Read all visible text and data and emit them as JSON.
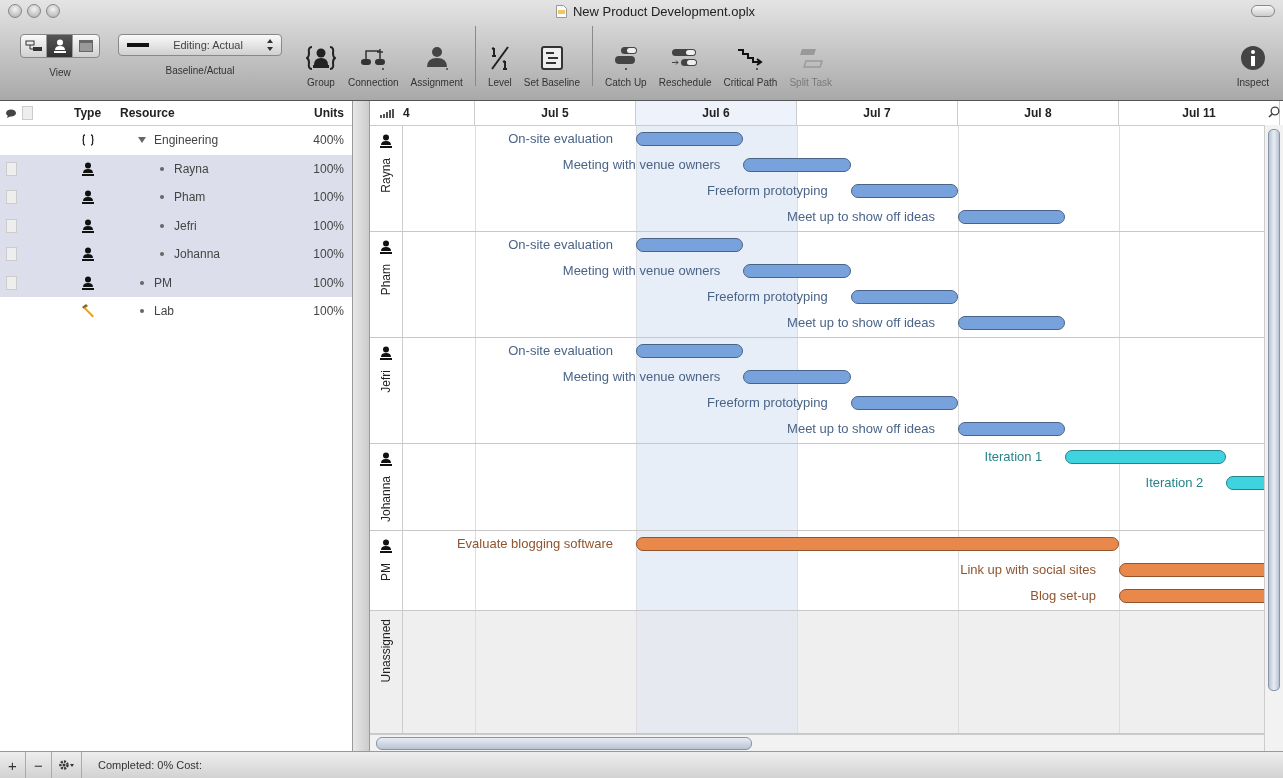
{
  "window": {
    "title": "New Product Development.oplx"
  },
  "toolbar": {
    "view": {
      "label": "View",
      "segments": [
        {
          "kind": "network",
          "selected": false
        },
        {
          "kind": "resource",
          "selected": true
        },
        {
          "kind": "calendar",
          "selected": false
        }
      ]
    },
    "baseline": {
      "label": "Baseline/Actual",
      "value": "Editing: Actual"
    },
    "buttons": [
      {
        "kind": "group",
        "label": "Group",
        "disabled": false
      },
      {
        "kind": "connection",
        "label": "Connection",
        "disabled": false
      },
      {
        "kind": "assignment",
        "label": "Assignment",
        "disabled": false
      },
      {
        "kind": "level",
        "label": "Level",
        "disabled": false
      },
      {
        "kind": "baseline",
        "label": "Set Baseline",
        "disabled": false
      },
      {
        "kind": "catchup",
        "label": "Catch Up",
        "disabled": false
      },
      {
        "kind": "reschedule",
        "label": "Reschedule",
        "disabled": false
      },
      {
        "kind": "critical",
        "label": "Critical Path",
        "disabled": false
      },
      {
        "kind": "split",
        "label": "Split Task",
        "disabled": true
      },
      {
        "kind": "inspect",
        "label": "Inspect",
        "disabled": false
      }
    ]
  },
  "resource_table": {
    "columns": [
      "Type",
      "Resource",
      "Units"
    ],
    "rows": [
      {
        "kind": "group",
        "name": "Engineering",
        "units": "400%",
        "selected": false,
        "expanded": true,
        "children": [
          {
            "kind": "person",
            "name": "Rayna",
            "units": "100%",
            "selected": true
          },
          {
            "kind": "person",
            "name": "Pham",
            "units": "100%",
            "selected": true
          },
          {
            "kind": "person",
            "name": "Jefri",
            "units": "100%",
            "selected": true
          },
          {
            "kind": "person",
            "name": "Johanna",
            "units": "100%",
            "selected": true
          }
        ]
      },
      {
        "kind": "person",
        "name": "PM",
        "units": "100%",
        "selected": true
      },
      {
        "kind": "equipment",
        "name": "Lab",
        "units": "100%",
        "selected": false
      }
    ]
  },
  "gantt": {
    "first_column": "4",
    "days": [
      {
        "label": "Jul 5",
        "selected": false
      },
      {
        "label": "Jul 6",
        "selected": true
      },
      {
        "label": "Jul 7",
        "selected": false
      },
      {
        "label": "Jul 8",
        "selected": false
      },
      {
        "label": "Jul 11",
        "selected": false
      }
    ],
    "lanes": [
      {
        "kind": "person",
        "name": "Rayna",
        "tasks": [
          {
            "label": "On-site evaluation",
            "color": "#78a2dc"
          },
          {
            "label": "Meeting with venue owners",
            "color": "#78a2dc"
          },
          {
            "label": "Freeform prototyping",
            "color": "#78a2dc"
          },
          {
            "label": "Meet up to show off ideas",
            "color": "#78a2dc"
          }
        ]
      },
      {
        "kind": "person",
        "name": "Pham",
        "tasks": [
          {
            "label": "On-site evaluation",
            "color": "#78a2dc"
          },
          {
            "label": "Meeting with venue owners",
            "color": "#78a2dc"
          },
          {
            "label": "Freeform prototyping",
            "color": "#78a2dc"
          },
          {
            "label": "Meet up to show off ideas",
            "color": "#78a2dc"
          }
        ]
      },
      {
        "kind": "person",
        "name": "Jefri",
        "tasks": [
          {
            "label": "On-site evaluation",
            "color": "#78a2dc"
          },
          {
            "label": "Meeting with venue owners",
            "color": "#78a2dc"
          },
          {
            "label": "Freeform prototyping",
            "color": "#78a2dc"
          },
          {
            "label": "Meet up to show off ideas",
            "color": "#78a2dc"
          }
        ]
      },
      {
        "kind": "person",
        "name": "Johanna",
        "tasks": [
          {
            "label": "Iteration 1",
            "color": "#3fd3df"
          },
          {
            "label": "Iteration 2",
            "color": "#3fd3df"
          }
        ]
      },
      {
        "kind": "person",
        "name": "PM",
        "tasks": [
          {
            "label": "Evaluate blogging software",
            "color": "#e8884a"
          },
          {
            "label": "Link up with social sites",
            "color": "#e8884a"
          },
          {
            "label": "Blog set-up",
            "color": "#e8884a"
          }
        ]
      },
      {
        "kind": "unassigned",
        "name": "Unassigned"
      }
    ]
  },
  "status_bar": {
    "add": "+",
    "remove": "−",
    "text": "Completed: 0% Cost:"
  }
}
